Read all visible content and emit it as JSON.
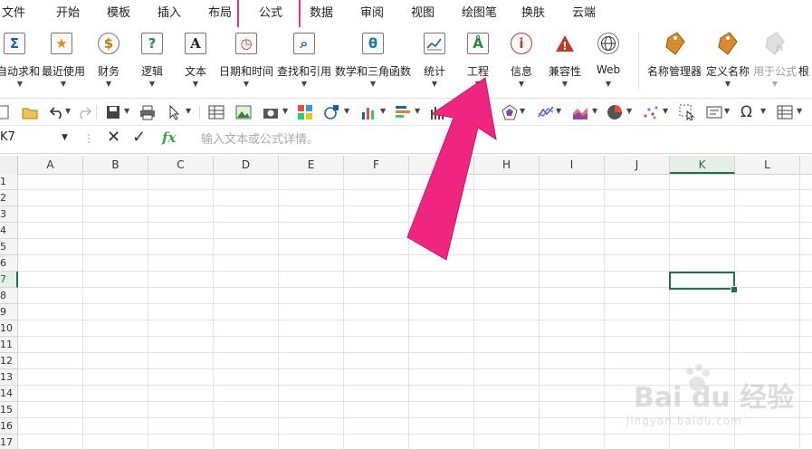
{
  "menu": {
    "items": [
      "文件",
      "开始",
      "模板",
      "插入",
      "布局",
      "公式",
      "数据",
      "审阅",
      "视图",
      "绘图笔",
      "换肤",
      "云端"
    ],
    "active_index": 5
  },
  "ribbon": {
    "buttons": [
      {
        "label": "自动求和",
        "icon": "sum-icon",
        "glyph": "Σ"
      },
      {
        "label": "最近使用",
        "icon": "star-icon",
        "glyph": "★"
      },
      {
        "label": "财务",
        "icon": "money-bag-icon",
        "glyph": "$"
      },
      {
        "label": "逻辑",
        "icon": "question-icon",
        "glyph": "?"
      },
      {
        "label": "文本",
        "icon": "text-icon",
        "glyph": "A"
      },
      {
        "label": "日期和时间",
        "icon": "clock-icon",
        "glyph": "◷"
      },
      {
        "label": "查找和引用",
        "icon": "magnifier-icon",
        "glyph": "⌕"
      },
      {
        "label": "数学和三角函数",
        "icon": "theta-icon",
        "glyph": "θ"
      },
      {
        "label": "统计",
        "icon": "chart-icon",
        "glyph": "📈"
      },
      {
        "label": "工程",
        "icon": "compass-icon",
        "glyph": "Å"
      },
      {
        "label": "信息",
        "icon": "info-icon",
        "glyph": "ⓘ"
      },
      {
        "label": "兼容性",
        "icon": "warning-icon",
        "glyph": "!"
      },
      {
        "label": "Web",
        "icon": "globe-icon",
        "glyph": "◍"
      }
    ],
    "name_tools": [
      {
        "label": "名称管理器",
        "icon": "tag-icon"
      },
      {
        "label": "定义名称",
        "icon": "tag-icon"
      },
      {
        "label": "用于公式",
        "icon": "fx-tag-icon"
      },
      {
        "label": "根",
        "icon": "none"
      }
    ]
  },
  "formula_bar": {
    "name_box": "K7",
    "fx_label": "fx",
    "placeholder": "输入文本或公式详情。"
  },
  "grid": {
    "columns": [
      "A",
      "B",
      "C",
      "D",
      "E",
      "F",
      "G",
      "H",
      "I",
      "J",
      "K",
      "L"
    ],
    "rows": [
      "1",
      "2",
      "3",
      "4",
      "5",
      "6",
      "7",
      "8",
      "9",
      "10",
      "11",
      "12",
      "13",
      "14",
      "15",
      "16",
      "17"
    ],
    "selected_col": "K",
    "selected_row": "7"
  },
  "watermark": {
    "text": "Bai du 经验",
    "sub": "jingyan.baidu.com"
  },
  "colors": {
    "accent_pink": "#e4348a",
    "excel_green": "#217346",
    "fx_green": "#3aa24b"
  }
}
